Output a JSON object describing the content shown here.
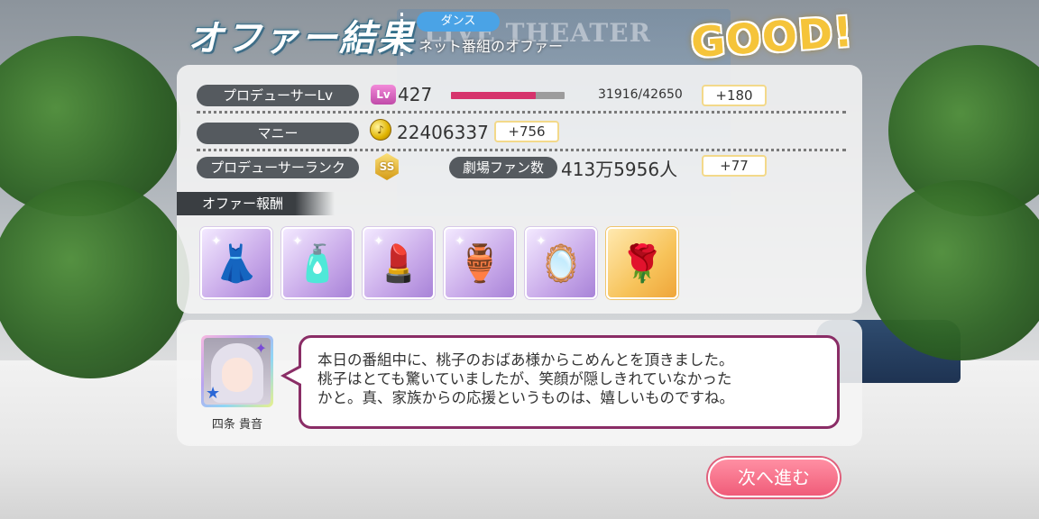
{
  "header": {
    "title": "オファー結果",
    "genre": "ダンス",
    "offer_name": "ネット番組のオファー",
    "result": "GOOD!",
    "background_sign": "LIVE THEATER"
  },
  "stats": {
    "producer_lv": {
      "label": "プロデューサーLv",
      "icon": "Lv",
      "value": "427",
      "xp": "31916/42650",
      "xp_progress": 0.748,
      "gain": "+180"
    },
    "money": {
      "label": "マニー",
      "icon": "coin-icon",
      "value": "22406337",
      "gain": "+756"
    },
    "rank": {
      "label": "プロデューサーランク",
      "icon": "SS",
      "fans_label": "劇場ファン数",
      "fans_value": "413万5956人",
      "gain": "+77"
    }
  },
  "rewards": {
    "header": "オファー報酬",
    "items": [
      {
        "name": "white-dress-icon",
        "glyph": "👗",
        "bg": "purple"
      },
      {
        "name": "pink-perfume-icon",
        "glyph": "🧴",
        "bg": "purple"
      },
      {
        "name": "lipstick-icon",
        "glyph": "💄",
        "bg": "purple"
      },
      {
        "name": "gold-perfume-icon",
        "glyph": "🏺",
        "bg": "purple"
      },
      {
        "name": "hand-mirror-icon",
        "glyph": "🪞",
        "bg": "purple"
      },
      {
        "name": "rose-icon",
        "glyph": "🌹",
        "bg": "orange"
      }
    ]
  },
  "dialog": {
    "character_name": "四条 貴音",
    "lines": [
      "本日の番組中に、桃子のおばあ様からこめんとを頂きました。",
      "桃子はとても驚いていましたが、笑顔が隠しきれていなかった",
      "かと。真、家族からの応援というものは、嬉しいものですね。"
    ]
  },
  "next_button": "次へ進む",
  "colors": {
    "accent_pink": "#f05c79",
    "xp_bar": "#d6336c",
    "bubble_border": "#8a2d66",
    "label_bg": "#555a5f",
    "good_gold": "#f5c43a"
  }
}
